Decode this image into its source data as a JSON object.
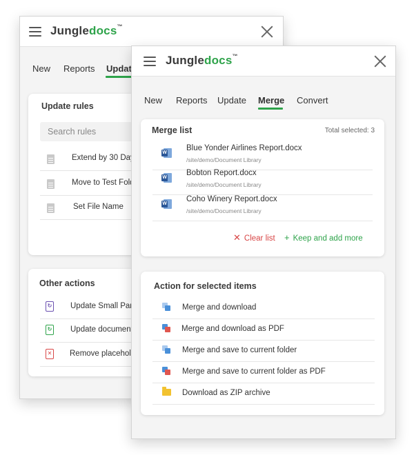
{
  "brand": {
    "logo_left": "Jungle",
    "logo_right": "docs",
    "trademark": "™"
  },
  "back_panel": {
    "tabs": [
      "New",
      "Reports",
      "Update"
    ],
    "update_rules": {
      "title": "Update rules",
      "search_placeholder": "Search rules",
      "items": [
        "Extend by 30 Days",
        "Move to Test Folder",
        "Set File Name"
      ]
    },
    "other_actions": {
      "title": "Other actions",
      "items": [
        {
          "label": "Update Small Parts",
          "icon": "update-parts-icon",
          "color": "#6a4fb0"
        },
        {
          "label": "Update document",
          "icon": "update-document-icon",
          "color": "#2ea34a"
        },
        {
          "label": "Remove placeholders",
          "icon": "remove-placeholder-icon",
          "color": "#d84545"
        }
      ]
    }
  },
  "front_panel": {
    "tabs": [
      "New",
      "Reports",
      "Update",
      "Merge",
      "Convert"
    ],
    "active_tab": "Merge",
    "merge_list": {
      "title": "Merge list",
      "total_selected": "Total selected: 3",
      "files": [
        {
          "name": "Blue Yonder Airlines Report.docx",
          "path": "/site/demo/Document Library"
        },
        {
          "name": "Bobton Report.docx",
          "path": "/site/demo/Document Library"
        },
        {
          "name": "Coho Winery Report.docx",
          "path": "/site/demo/Document Library"
        }
      ],
      "clear_label": "Clear list",
      "keep_label": "Keep and add more"
    },
    "actions": {
      "title": "Action for selected items",
      "items": [
        "Merge and download",
        "Merge and download as PDF",
        "Merge and save to current folder",
        "Merge and save to current folder as PDF",
        "Download as ZIP archive"
      ]
    }
  },
  "colors": {
    "brand_green": "#2ea34a",
    "clear_red": "#d84545",
    "word_blue": "#2b5797",
    "merge_blue": "#4a90d9",
    "pdf_red": "#e0564f",
    "folder_yellow": "#f2c230"
  }
}
